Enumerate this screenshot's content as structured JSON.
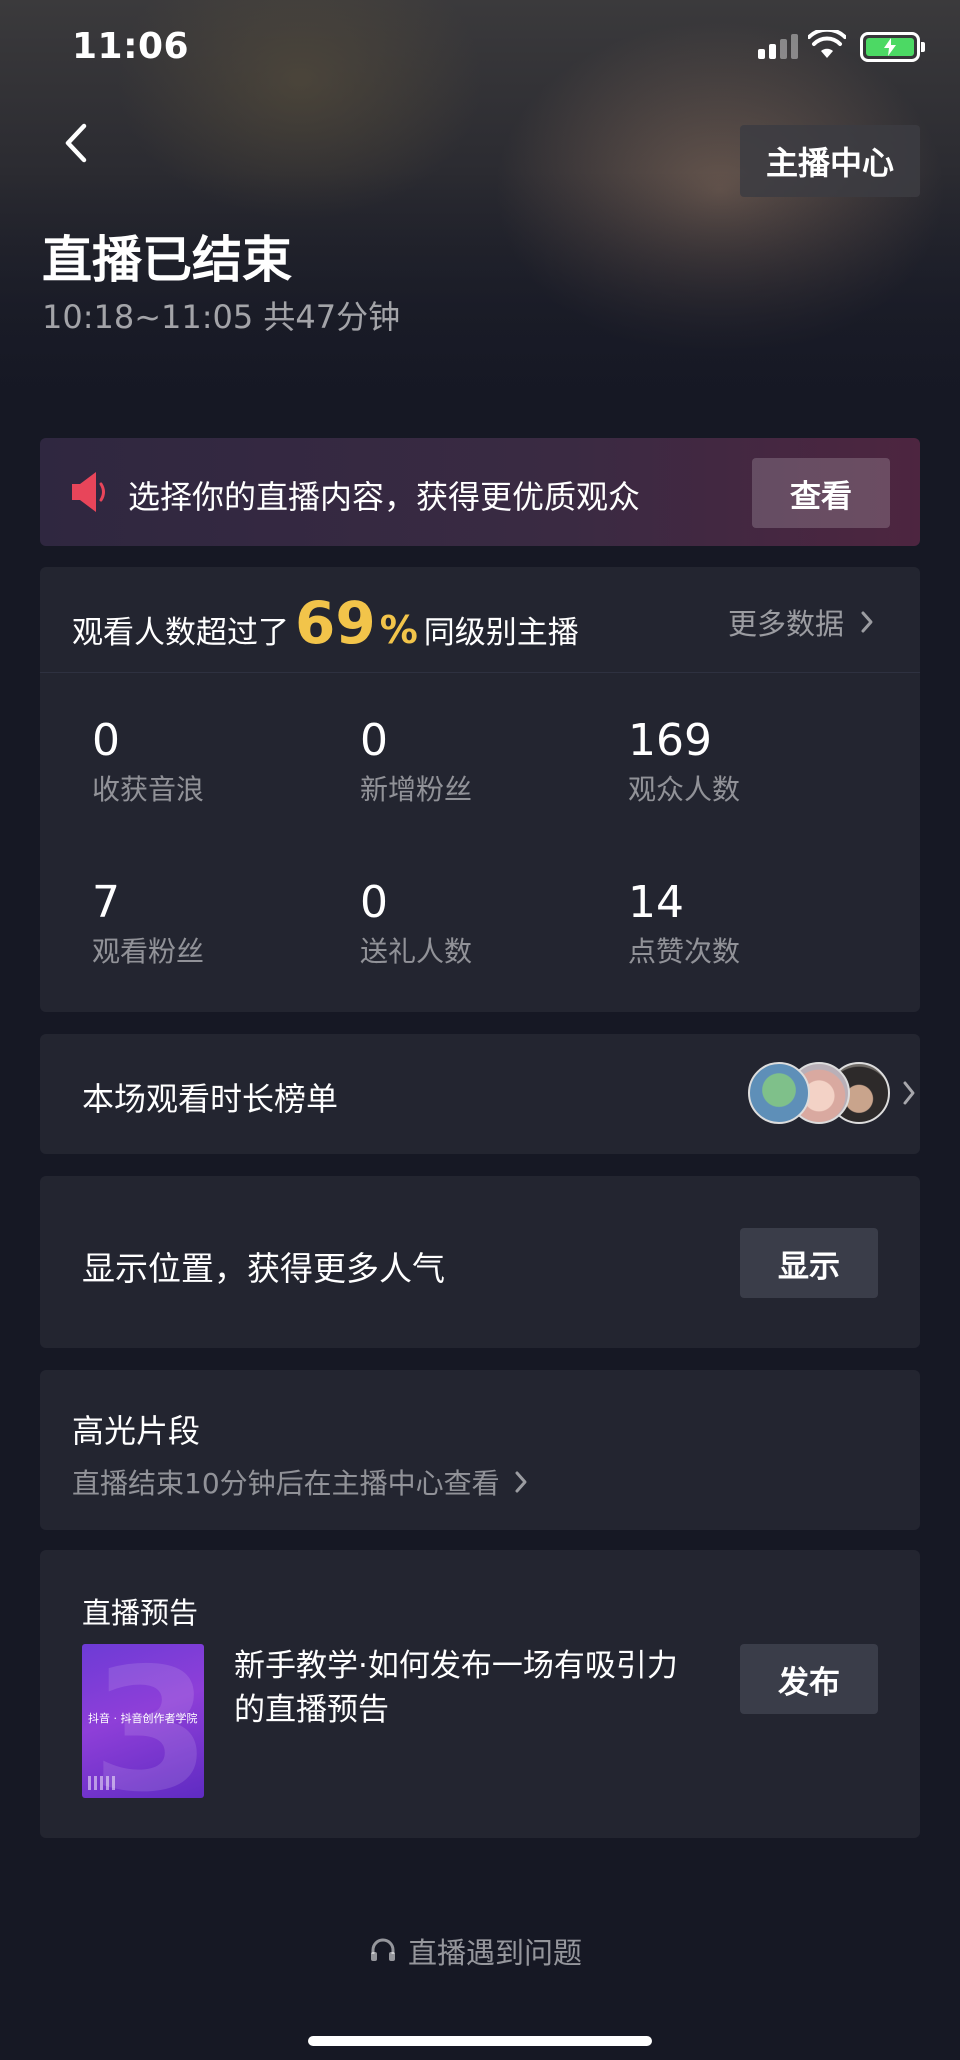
{
  "status_bar": {
    "time": "11:06"
  },
  "header": {
    "anchor_center_label": "主播中心",
    "title": "直播已结束",
    "session_time": "10:18~11:05 共47分钟"
  },
  "promo": {
    "text": "选择你的直播内容，获得更优质观众",
    "button": "查看"
  },
  "stats": {
    "compare_prefix": "观看人数超过了",
    "compare_value": "69",
    "compare_unit": "%",
    "compare_suffix": "同级别主播",
    "more_data": "更多数据",
    "items": [
      {
        "value": "0",
        "label": "收获音浪"
      },
      {
        "value": "0",
        "label": "新增粉丝"
      },
      {
        "value": "169",
        "label": "观众人数"
      },
      {
        "value": "7",
        "label": "观看粉丝"
      },
      {
        "value": "0",
        "label": "送礼人数"
      },
      {
        "value": "14",
        "label": "点赞次数"
      }
    ]
  },
  "ranking": {
    "title": "本场观看时长榜单"
  },
  "location": {
    "title": "显示位置，获得更多人气",
    "button": "显示"
  },
  "highlights": {
    "title": "高光片段",
    "subtitle": "直播结束10分钟后在主播中心查看"
  },
  "preview": {
    "title": "直播预告",
    "thumbnail_brand": "抖音 · 抖音创作者学院",
    "description": "新手教学·如何发布一场有吸引力的直播预告",
    "button": "发布"
  },
  "help": {
    "label": "直播遇到问题"
  },
  "colors": {
    "accent_yellow": "#f2c44a",
    "background": "#161824",
    "card": "#232530",
    "battery_green": "#4cd964"
  }
}
